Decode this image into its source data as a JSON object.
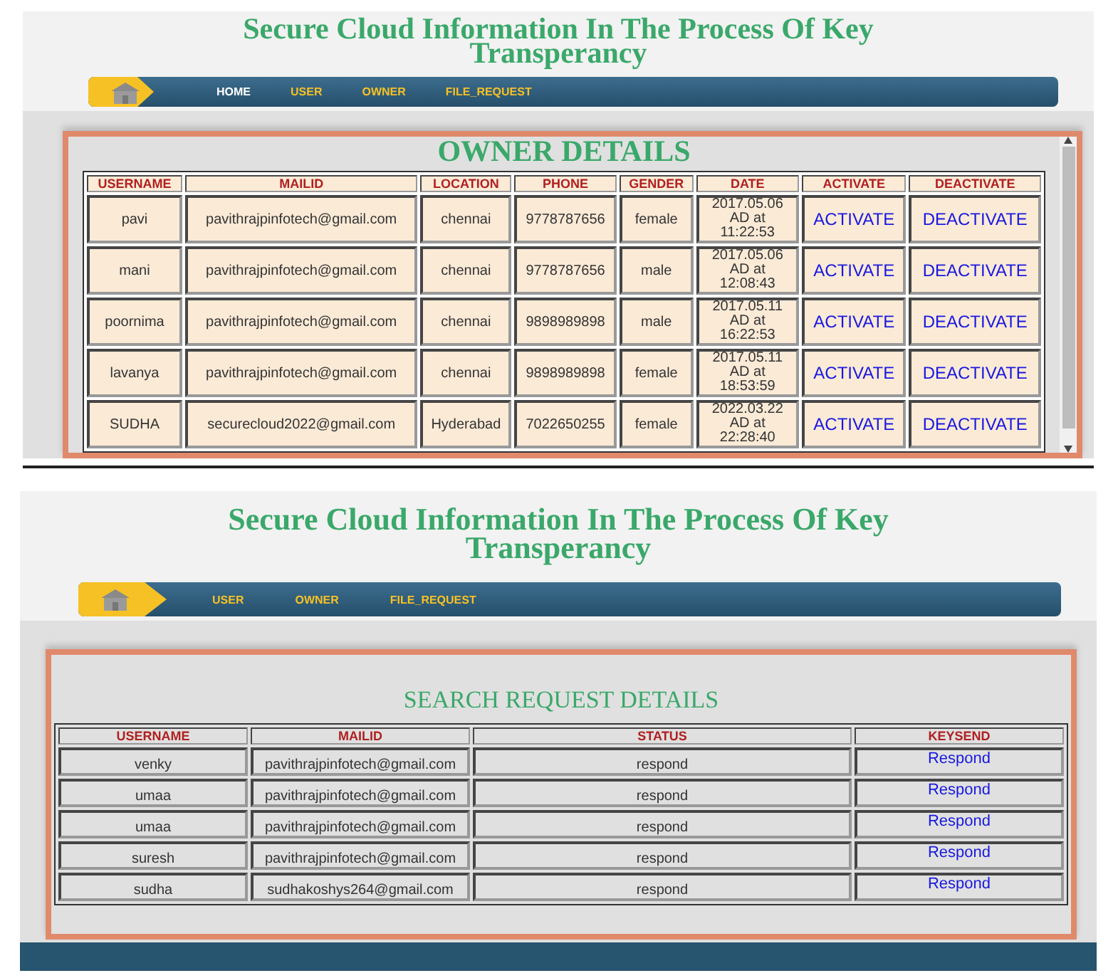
{
  "panels": [
    {
      "title": "Secure Cloud Information In The Process Of Key Transperancy",
      "scrollable": true,
      "nav": [
        {
          "label": "HOME",
          "selected": true
        },
        {
          "label": "USER",
          "selected": false
        },
        {
          "label": "OWNER",
          "selected": false
        },
        {
          "label": "FILE_REQUEST",
          "selected": false
        }
      ],
      "heading": {
        "text": "OWNER DETAILS",
        "bold": true
      },
      "columns": [
        {
          "label": "USERNAME",
          "kind": "text"
        },
        {
          "label": "MAILID",
          "kind": "text"
        },
        {
          "label": "LOCATION",
          "kind": "text"
        },
        {
          "label": "PHONE",
          "kind": "text"
        },
        {
          "label": "GENDER",
          "kind": "text"
        },
        {
          "label": "DATE",
          "kind": "date"
        },
        {
          "label": "ACTIVATE",
          "kind": "link"
        },
        {
          "label": "DEACTIVATE",
          "kind": "link"
        }
      ],
      "rows": [
        [
          "pavi",
          "pavithrajpinfotech@gmail.com",
          "chennai",
          "9778787656",
          "female",
          "2017.05.06 AD at 11:22:53",
          "ACTIVATE",
          "DEACTIVATE"
        ],
        [
          "mani",
          "pavithrajpinfotech@gmail.com",
          "chennai",
          "9778787656",
          "male",
          "2017.05.06 AD at 12:08:43",
          "ACTIVATE",
          "DEACTIVATE"
        ],
        [
          "poornima",
          "pavithrajpinfotech@gmail.com",
          "chennai",
          "9898989898",
          "male",
          "2017.05.11 AD at 16:22:53",
          "ACTIVATE",
          "DEACTIVATE"
        ],
        [
          "lavanya",
          "pavithrajpinfotech@gmail.com",
          "chennai",
          "9898989898",
          "female",
          "2017.05.11 AD at 18:53:59",
          "ACTIVATE",
          "DEACTIVATE"
        ],
        [
          "SUDHA",
          "securecloud2022@gmail.com",
          "Hyderabad",
          "7022650255",
          "female",
          "2022.03.22 AD at 22:28:40",
          "ACTIVATE",
          "DEACTIVATE"
        ]
      ]
    },
    {
      "title": "Secure Cloud Information In The Process Of Key Transperancy",
      "scrollable": false,
      "nav": [
        {
          "label": "USER",
          "selected": false
        },
        {
          "label": "OWNER",
          "selected": false
        },
        {
          "label": "FILE_REQUEST",
          "selected": false
        }
      ],
      "heading": {
        "text": "SEARCH REQUEST DETAILS",
        "bold": false
      },
      "columns": [
        {
          "label": "USERNAME",
          "kind": "text"
        },
        {
          "label": "MAILID",
          "kind": "text"
        },
        {
          "label": "STATUS",
          "kind": "text"
        },
        {
          "label": "KEYSEND",
          "kind": "link"
        }
      ],
      "rows": [
        [
          "venky",
          "pavithrajpinfotech@gmail.com",
          "respond",
          "Respond"
        ],
        [
          "umaa",
          "pavithrajpinfotech@gmail.com",
          "respond",
          "Respond"
        ],
        [
          "umaa",
          "pavithrajpinfotech@gmail.com",
          "respond",
          "Respond"
        ],
        [
          "suresh",
          "pavithrajpinfotech@gmail.com",
          "respond",
          "Respond"
        ],
        [
          "sudha",
          "sudhakoshys264@gmail.com",
          "respond",
          "Respond"
        ]
      ]
    }
  ]
}
